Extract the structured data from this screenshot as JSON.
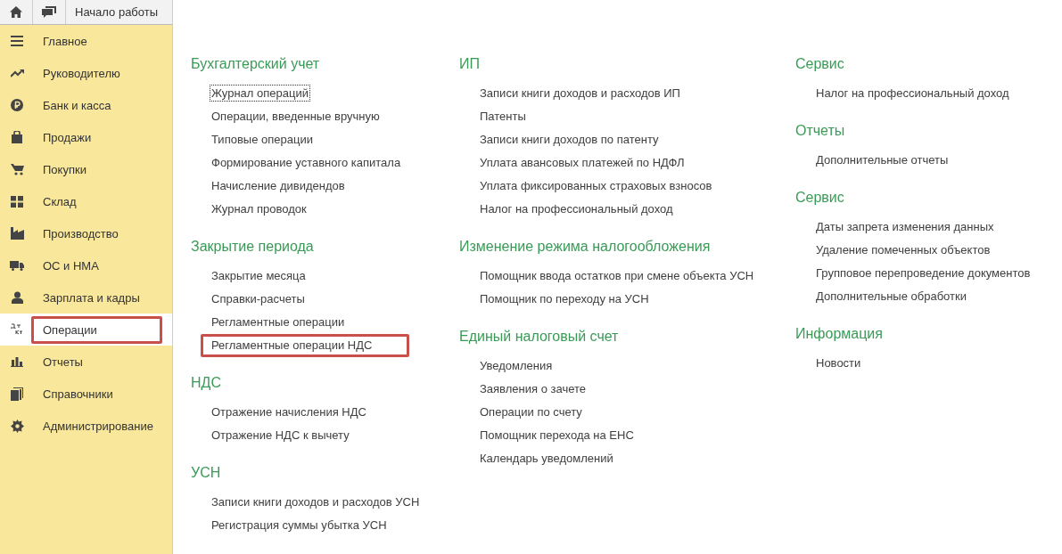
{
  "top_bar": {
    "tab": "Начало работы"
  },
  "sidebar": {
    "items": [
      {
        "label": "Главное",
        "selected": false,
        "highlighted": false
      },
      {
        "label": "Руководителю",
        "selected": false,
        "highlighted": false
      },
      {
        "label": "Банк и касса",
        "selected": false,
        "highlighted": false
      },
      {
        "label": "Продажи",
        "selected": false,
        "highlighted": false
      },
      {
        "label": "Покупки",
        "selected": false,
        "highlighted": false
      },
      {
        "label": "Склад",
        "selected": false,
        "highlighted": false
      },
      {
        "label": "Производство",
        "selected": false,
        "highlighted": false
      },
      {
        "label": "ОС и НМА",
        "selected": false,
        "highlighted": false
      },
      {
        "label": "Зарплата и кадры",
        "selected": false,
        "highlighted": false
      },
      {
        "label": "Операции",
        "selected": true,
        "highlighted": true
      },
      {
        "label": "Отчеты",
        "selected": false,
        "highlighted": false
      },
      {
        "label": "Справочники",
        "selected": false,
        "highlighted": false
      },
      {
        "label": "Администрирование",
        "selected": false,
        "highlighted": false
      }
    ]
  },
  "columns": [
    [
      {
        "title": "Бухгалтерский учет",
        "links": [
          {
            "label": "Журнал операций",
            "focused": true,
            "highlighted": false
          },
          {
            "label": "Операции, введенные вручную",
            "focused": false,
            "highlighted": false
          },
          {
            "label": "Типовые операции",
            "focused": false,
            "highlighted": false
          },
          {
            "label": "Формирование уставного капитала",
            "focused": false,
            "highlighted": false
          },
          {
            "label": "Начисление дивидендов",
            "focused": false,
            "highlighted": false
          },
          {
            "label": "Журнал проводок",
            "focused": false,
            "highlighted": false
          }
        ]
      },
      {
        "title": "Закрытие периода",
        "links": [
          {
            "label": "Закрытие месяца",
            "focused": false,
            "highlighted": false
          },
          {
            "label": "Справки-расчеты",
            "focused": false,
            "highlighted": false
          },
          {
            "label": "Регламентные операции",
            "focused": false,
            "highlighted": false
          },
          {
            "label": "Регламентные операции НДС",
            "focused": false,
            "highlighted": true
          }
        ]
      },
      {
        "title": "НДС",
        "links": [
          {
            "label": "Отражение начисления НДС",
            "focused": false,
            "highlighted": false
          },
          {
            "label": "Отражение НДС к вычету",
            "focused": false,
            "highlighted": false
          }
        ]
      },
      {
        "title": "УСН",
        "links": [
          {
            "label": "Записи книги доходов и расходов УСН",
            "focused": false,
            "highlighted": false
          },
          {
            "label": "Регистрация суммы убытка УСН",
            "focused": false,
            "highlighted": false
          }
        ]
      }
    ],
    [
      {
        "title": "ИП",
        "links": [
          {
            "label": "Записи книги доходов и расходов ИП",
            "focused": false,
            "highlighted": false
          },
          {
            "label": "Патенты",
            "focused": false,
            "highlighted": false
          },
          {
            "label": "Записи книги доходов по патенту",
            "focused": false,
            "highlighted": false
          },
          {
            "label": "Уплата авансовых платежей по НДФЛ",
            "focused": false,
            "highlighted": false
          },
          {
            "label": "Уплата фиксированных страховых взносов",
            "focused": false,
            "highlighted": false
          },
          {
            "label": "Налог на профессиональный доход",
            "focused": false,
            "highlighted": false
          }
        ]
      },
      {
        "title": "Изменение режима налогообложения",
        "links": [
          {
            "label": "Помощник ввода остатков при смене объекта УСН",
            "focused": false,
            "highlighted": false
          },
          {
            "label": "Помощник по переходу на УСН",
            "focused": false,
            "highlighted": false
          }
        ]
      },
      {
        "title": "Единый налоговый счет",
        "links": [
          {
            "label": "Уведомления",
            "focused": false,
            "highlighted": false
          },
          {
            "label": "Заявления о зачете",
            "focused": false,
            "highlighted": false
          },
          {
            "label": "Операции по счету",
            "focused": false,
            "highlighted": false
          },
          {
            "label": "Помощник перехода на ЕНС",
            "focused": false,
            "highlighted": false
          },
          {
            "label": "Календарь уведомлений",
            "focused": false,
            "highlighted": false
          }
        ]
      }
    ],
    [
      {
        "title": "Сервис",
        "links": [
          {
            "label": "Налог на профессиональный доход",
            "focused": false,
            "highlighted": false
          }
        ]
      },
      {
        "title": "Отчеты",
        "links": [
          {
            "label": "Дополнительные отчеты",
            "focused": false,
            "highlighted": false
          }
        ]
      },
      {
        "title": "Сервис",
        "links": [
          {
            "label": "Даты запрета изменения данных",
            "focused": false,
            "highlighted": false
          },
          {
            "label": "Удаление помеченных объектов",
            "focused": false,
            "highlighted": false
          },
          {
            "label": "Групповое перепроведение документов",
            "focused": false,
            "highlighted": false
          },
          {
            "label": "Дополнительные обработки",
            "focused": false,
            "highlighted": false
          }
        ]
      },
      {
        "title": "Информация",
        "links": [
          {
            "label": "Новости",
            "focused": false,
            "highlighted": false
          }
        ]
      }
    ]
  ]
}
